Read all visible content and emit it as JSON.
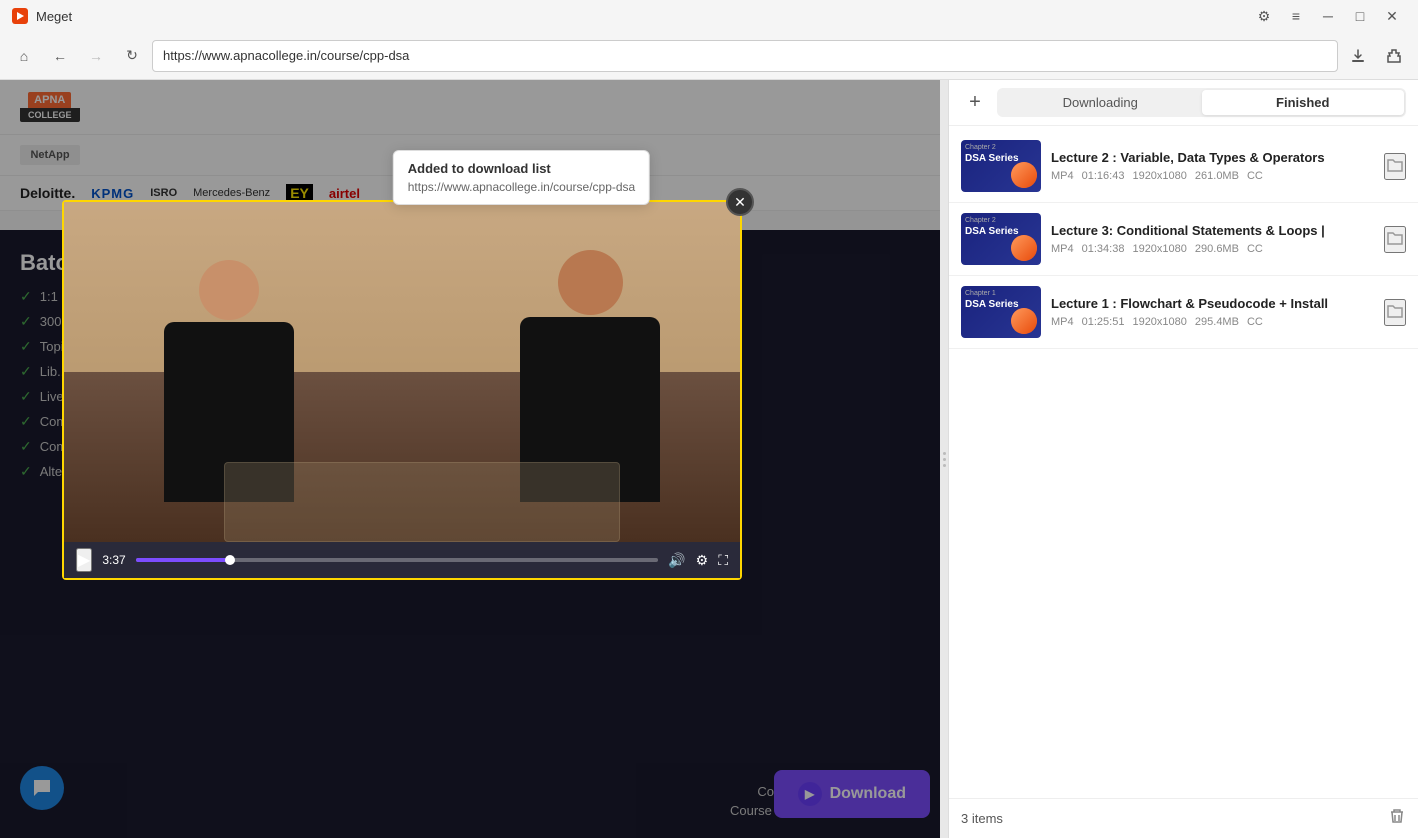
{
  "app": {
    "title": "Meget",
    "icon": "app-icon"
  },
  "titlebar": {
    "title": "Meget",
    "settings_label": "⚙",
    "menu_label": "≡",
    "minimize_label": "─",
    "maximize_label": "□",
    "close_label": "✕"
  },
  "navbar": {
    "back_label": "←",
    "forward_label": "→",
    "refresh_label": "↻",
    "home_label": "⌂",
    "url": "https://www.apnacollege.in/course/cpp-dsa",
    "download_icon": "⬇",
    "extension_icon": "🧩"
  },
  "tooltip": {
    "title": "Added to download list",
    "url": "https://www.apnacollege.in/course/cpp-dsa"
  },
  "webpage": {
    "logo_top": "APNA",
    "logo_bottom": "COLLEGE",
    "companies": [
      "NetApp",
      "Deloitte.",
      "KPMG",
      "ISRO",
      "Mercedes-Benz",
      "EY",
      "airtel"
    ],
    "batch_title": "Batch",
    "features": [
      "1:1 D...",
      "300+...",
      "Topics...",
      "Lib...",
      "Live ...",
      "Complete C++ Language",
      "Complete Data Structures & Algorithms",
      "Alternate Day Lecture Schedule"
    ],
    "course_duration": "Course Duration – 4 months",
    "course_access": "Course access is for 15 months."
  },
  "video": {
    "time": "3:37",
    "close_label": "✕"
  },
  "download_button": {
    "label": "Download",
    "icon": "▶"
  },
  "panel": {
    "add_label": "+",
    "tab_downloading": "Downloading",
    "tab_finished": "Finished",
    "items": [
      {
        "title": "Lecture 2 : Variable, Data Types & Operators",
        "format": "MP4",
        "duration": "01:16:43",
        "resolution": "1920x1080",
        "size": "261.0MB",
        "cc": "CC",
        "chapter": "Chapter 2",
        "series": "DSA Series",
        "thumb_variant": "1"
      },
      {
        "title": "Lecture 3: Conditional Statements & Loops |",
        "format": "MP4",
        "duration": "01:34:38",
        "resolution": "1920x1080",
        "size": "290.6MB",
        "cc": "CC",
        "chapter": "Chapter 2",
        "series": "DSA Series",
        "thumb_variant": "2"
      },
      {
        "title": "Lecture 1 : Flowchart & Pseudocode + Install",
        "format": "MP4",
        "duration": "01:25:51",
        "resolution": "1920x1080",
        "size": "295.4MB",
        "cc": "CC",
        "chapter": "Chapter 1",
        "series": "DSA Series",
        "thumb_variant": "3"
      }
    ],
    "footer": {
      "items_count": "3 items",
      "delete_label": "🗑"
    }
  }
}
